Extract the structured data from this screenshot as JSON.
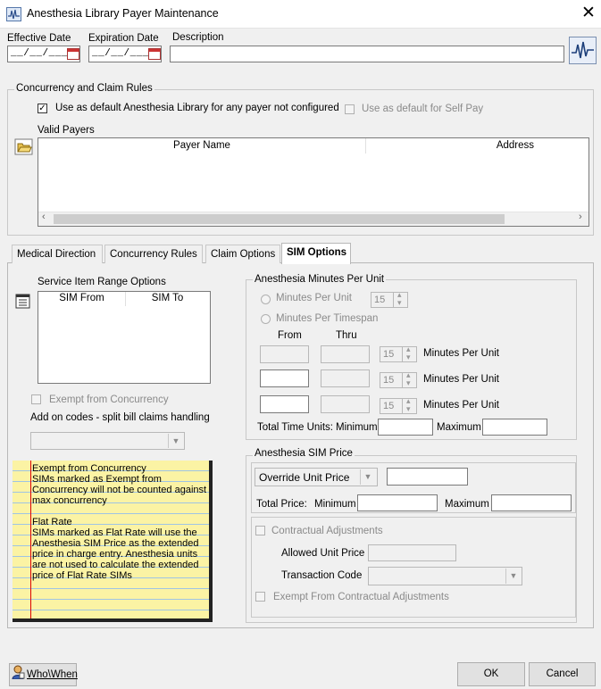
{
  "window": {
    "title": "Anesthesia Library Payer Maintenance"
  },
  "header": {
    "effective_label": "Effective Date",
    "effective_value": "__/__/____",
    "expiration_label": "Expiration Date",
    "expiration_value": "__/__/____",
    "description_label": "Description",
    "description_value": ""
  },
  "concurrency_group": {
    "title": "Concurrency and Claim Rules",
    "default_any_payer_label": "Use as default Anesthesia Library for any payer not configured",
    "default_any_payer_checked": true,
    "default_self_pay_label": "Use as default for Self Pay",
    "default_self_pay_checked": false,
    "valid_payers_label": "Valid Payers",
    "columns": [
      "Payer Name",
      "Address"
    ],
    "rows": []
  },
  "tabs": [
    {
      "label": "Medical Direction",
      "active": false
    },
    {
      "label": "Concurrency Rules",
      "active": false
    },
    {
      "label": "Claim Options",
      "active": false
    },
    {
      "label": "SIM Options",
      "active": true
    }
  ],
  "sim_options": {
    "range_title": "Service Item Range Options",
    "range_columns": [
      "SIM From",
      "SIM To"
    ],
    "exempt_label": "Exempt from Concurrency",
    "addon_label": "Add on codes - split bill claims handling",
    "addon_value": "",
    "note_lines": [
      "Exempt from Concurrency",
      "SIMs marked as Exempt from",
      "Concurrency will not be counted against",
      "max concurrency",
      "",
      "Flat Rate",
      "SIMs marked as Flat Rate will use the",
      "Anesthesia SIM Price as the extended",
      "price in charge entry. Anesthesia units",
      "are not used to calculate the extended",
      "price of Flat Rate SIMs"
    ]
  },
  "minutes_group": {
    "title": "Anesthesia Minutes Per Unit",
    "minutes_per_unit_label": "Minutes Per Unit",
    "minutes_per_unit_value": "15",
    "minutes_per_timespan_label": "Minutes Per Timespan",
    "from_label": "From",
    "thru_label": "Thru",
    "rows": [
      {
        "from": "",
        "thru": "",
        "minutes": "15",
        "label": "Minutes Per Unit"
      },
      {
        "from": "",
        "thru": "",
        "minutes": "15",
        "label": "Minutes Per Unit"
      },
      {
        "from": "",
        "thru": "",
        "minutes": "15",
        "label": "Minutes Per Unit"
      }
    ],
    "total_units_label": "Total Time Units:",
    "minimum_label": "Minimum",
    "maximum_label": "Maximum"
  },
  "price_group": {
    "title": "Anesthesia SIM Price",
    "price_type_value": "Override Unit Price",
    "unit_price_value": "",
    "total_price_label": "Total Price:",
    "minimum_label": "Minimum",
    "maximum_label": "Maximum",
    "contractual_label": "Contractual Adjustments",
    "allowed_unit_price_label": "Allowed Unit Price",
    "transaction_code_label": "Transaction Code",
    "exempt_contractual_label": "Exempt From Contractual Adjustments"
  },
  "footer": {
    "who_when_label": "Who\\When",
    "ok_label": "OK",
    "cancel_label": "Cancel"
  },
  "icons": [
    "app-icon",
    "close-icon",
    "calendar-icon",
    "waveform-icon",
    "folder-open-icon",
    "list-icon",
    "chevron-down-icon",
    "who-when-icon"
  ]
}
